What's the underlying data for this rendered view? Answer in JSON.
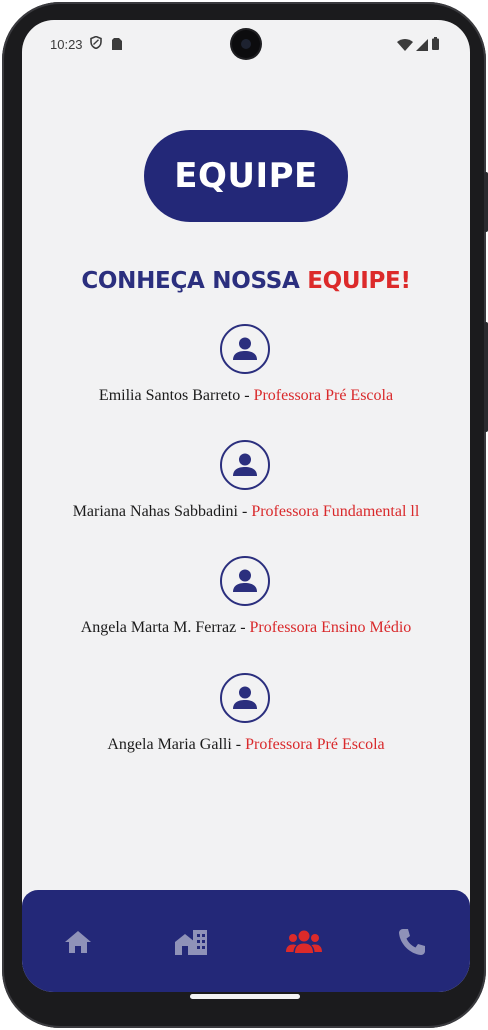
{
  "status_bar": {
    "time": "10:23",
    "icons": [
      "shield-icon",
      "sim-card-icon",
      "wifi-icon",
      "signal-icon",
      "battery-icon"
    ]
  },
  "header": {
    "title": "EQUIPE"
  },
  "section": {
    "heading_part1": "CONHEÇA NOSSA",
    "heading_part2": "EQUIPE!"
  },
  "members": [
    {
      "name": "Emilia Santos Barreto",
      "separator": " - ",
      "role": "Professora Pré Escola",
      "icon": "person-icon"
    },
    {
      "name": "Mariana Nahas Sabbadini",
      "separator": " - ",
      "role": "Professora Fundamental ll",
      "icon": "person-icon"
    },
    {
      "name": "Angela Marta M. Ferraz",
      "separator": " - ",
      "role": "Professora Ensino Médio",
      "icon": "person-icon"
    },
    {
      "name": "Angela Maria Galli",
      "separator": " - ",
      "role": "Professora Pré Escola",
      "icon": "person-icon"
    }
  ],
  "bottom_nav": {
    "items": [
      {
        "icon": "home-icon",
        "active": false
      },
      {
        "icon": "school-building-icon",
        "active": false
      },
      {
        "icon": "team-icon",
        "active": true
      },
      {
        "icon": "phone-icon",
        "active": false
      }
    ]
  },
  "colors": {
    "primary": "#232878",
    "accent": "#dc2a2a",
    "background": "#f2f2f3",
    "nav_inactive": "#8f92b8"
  }
}
